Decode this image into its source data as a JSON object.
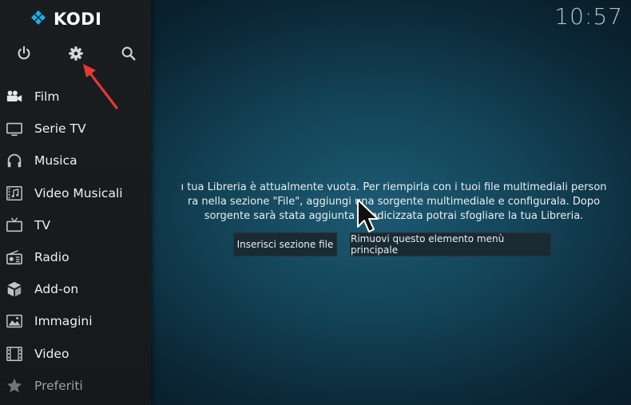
{
  "app": {
    "name": "KODI"
  },
  "clock": "10:57",
  "top_icons": [
    {
      "name": "power-icon"
    },
    {
      "name": "settings-gear-icon"
    },
    {
      "name": "search-icon"
    }
  ],
  "menu": [
    {
      "label": "Film",
      "icon": "movie-camera-icon"
    },
    {
      "label": "Serie TV",
      "icon": "tv-monitor-icon"
    },
    {
      "label": "Musica",
      "icon": "headphones-icon"
    },
    {
      "label": "Video Musicali",
      "icon": "music-video-icon"
    },
    {
      "label": "TV",
      "icon": "live-tv-icon"
    },
    {
      "label": "Radio",
      "icon": "radio-icon"
    },
    {
      "label": "Add-on",
      "icon": "addon-box-icon"
    },
    {
      "label": "Immagini",
      "icon": "pictures-icon"
    },
    {
      "label": "Video",
      "icon": "film-strip-icon"
    },
    {
      "label": "Preferiti",
      "icon": "star-icon"
    }
  ],
  "message": {
    "line1": "ı tua Libreria è attualmente vuota. Per riempirla con i tuoi file multimediali person",
    "line2": "ra nella sezione \"File\", aggiungi una sorgente multimediale e configurala. Dopo",
    "line3": "sorgente sarà stata aggiunta e indicizzata potrai sfogliare la tua Libreria."
  },
  "buttons": {
    "add_source": "Inserisci sezione file",
    "remove_item": "Rimuovi questo elemento menù principale"
  },
  "colors": {
    "sidebar_bg": "#1a1d20",
    "main_bg": "#134457",
    "annotation_arrow": "#e53935",
    "button_bg": "#1a2a33"
  }
}
